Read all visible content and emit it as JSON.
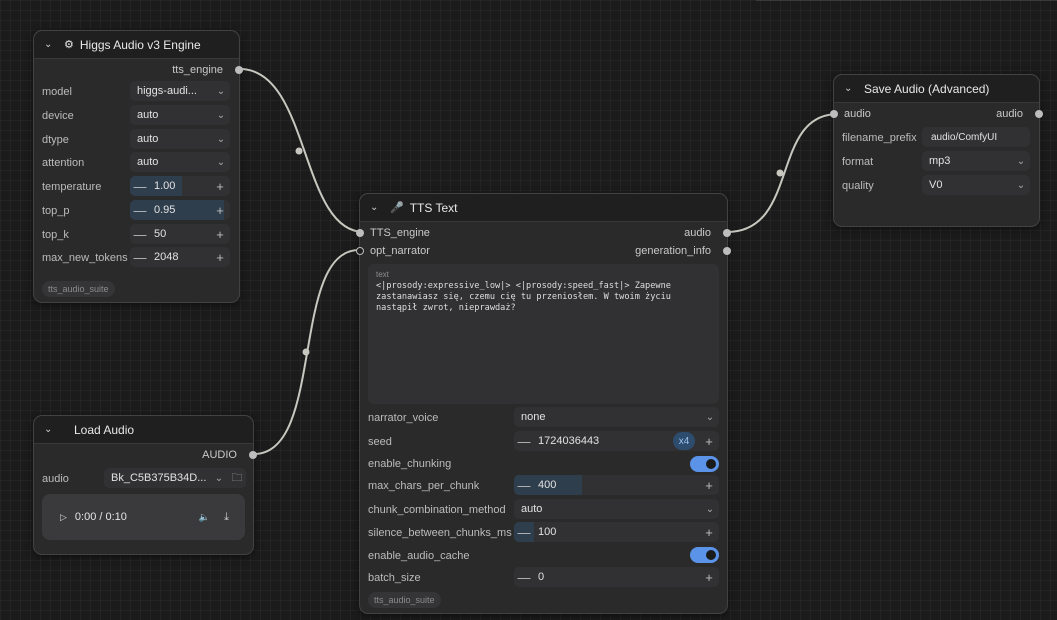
{
  "nodes": {
    "higgs": {
      "title": "Higgs Audio v3 Engine",
      "output": "tts_engine",
      "widgets": [
        {
          "label": "model",
          "value": "higgs-audi..."
        },
        {
          "label": "device",
          "value": "auto"
        },
        {
          "label": "dtype",
          "value": "auto"
        },
        {
          "label": "attention",
          "value": "auto"
        },
        {
          "label": "temperature",
          "value": "1.00"
        },
        {
          "label": "top_p",
          "value": "0.95"
        },
        {
          "label": "top_k",
          "value": "50"
        },
        {
          "label": "max_new_tokens",
          "value": "2048"
        }
      ],
      "badge": "tts_audio_suite"
    },
    "load_audio": {
      "title": "Load Audio",
      "output": "AUDIO",
      "audio_label": "audio",
      "audio_value": "Bk_C5B375B34D...",
      "player_time": "0:00 / 0:10"
    },
    "tts_text": {
      "title": "TTS Text",
      "inputs": [
        "TTS_engine",
        "opt_narrator"
      ],
      "outputs": [
        "audio",
        "generation_info"
      ],
      "text_label": "text",
      "text_value": "<|prosody:expressive_low|> <|prosody:speed_fast|> Zapewne\nzastanawiasz się, czemu cię tu przeniosłem. W twoim życiu\nnastąpił zwrot, nieprawdaż?",
      "widgets": {
        "narrator_voice": {
          "label": "narrator_voice",
          "value": "none"
        },
        "seed": {
          "label": "seed",
          "value": "1724036443",
          "chip": "x4"
        },
        "enable_chunking": {
          "label": "enable_chunking",
          "value": true
        },
        "max_chars_per_chunk": {
          "label": "max_chars_per_chunk",
          "value": "400"
        },
        "chunk_combination_method": {
          "label": "chunk_combination_method",
          "value": "auto"
        },
        "silence_between_chunks_ms": {
          "label": "silence_between_chunks_ms",
          "value": "100"
        },
        "enable_audio_cache": {
          "label": "enable_audio_cache",
          "value": true
        },
        "batch_size": {
          "label": "batch_size",
          "value": "0"
        }
      },
      "badge": "tts_audio_suite"
    },
    "save_audio": {
      "title": "Save Audio (Advanced)",
      "input": "audio",
      "output": "audio",
      "widgets": [
        {
          "label": "filename_prefix",
          "value": "audio/ComfyUI"
        },
        {
          "label": "format",
          "value": "mp3"
        },
        {
          "label": "quality",
          "value": "V0"
        }
      ]
    }
  },
  "colors": {
    "toggle_on": "#5a93e8",
    "link": "#c8c8c0",
    "slider_fill": "#2f3e4d"
  },
  "icons": {
    "higgs": "gear-icon",
    "tts_text": "microphone-icon",
    "folder": "folder-icon",
    "play": "play-icon",
    "volume": "volume-icon",
    "download": "download-icon"
  }
}
